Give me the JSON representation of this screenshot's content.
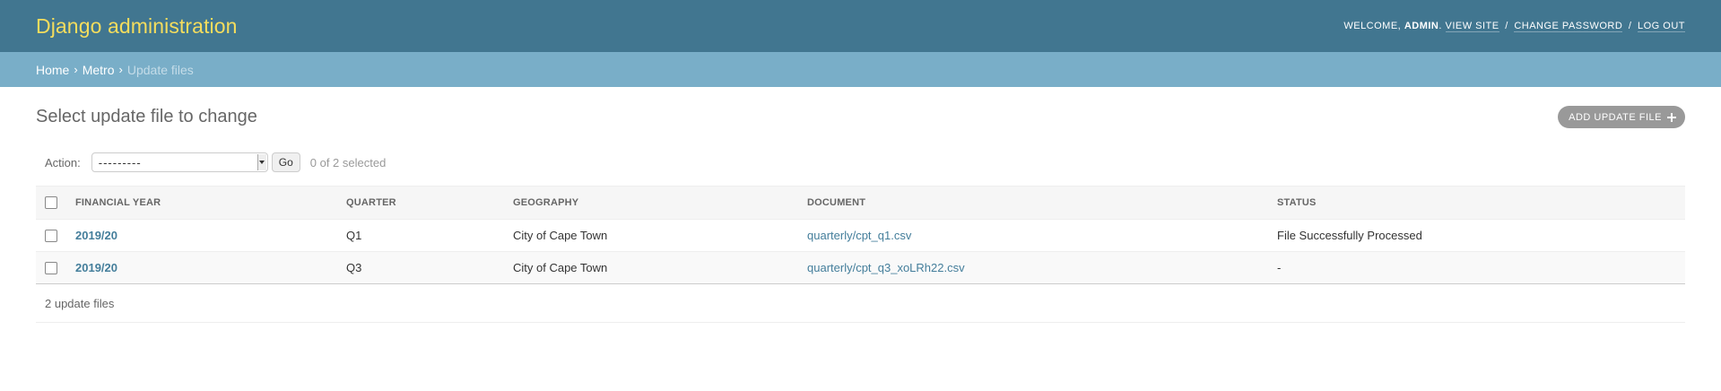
{
  "header": {
    "brand": "Django administration",
    "welcome_prefix": "Welcome,",
    "username": "admin",
    "view_site": "View site",
    "change_password": "Change password",
    "log_out": "Log out"
  },
  "breadcrumbs": {
    "home": "Home",
    "app": "Metro",
    "current": "Update files",
    "separator": "›"
  },
  "page": {
    "title": "Select update file to change",
    "add_button": "Add update file"
  },
  "actions": {
    "label": "Action:",
    "selected_option": "---------",
    "go": "Go",
    "selection_count": "0 of 2 selected"
  },
  "table": {
    "columns": [
      "Financial year",
      "Quarter",
      "Geography",
      "Document",
      "Status"
    ],
    "rows": [
      {
        "financial_year": "2019/20",
        "quarter": "Q1",
        "geography": "City of Cape Town",
        "document": "quarterly/cpt_q1.csv",
        "status": "File Successfully Processed"
      },
      {
        "financial_year": "2019/20",
        "quarter": "Q3",
        "geography": "City of Cape Town",
        "document": "quarterly/cpt_q3_xoLRh22.csv",
        "status": "-"
      }
    ]
  },
  "paginator": {
    "text": "2 update files"
  },
  "colors": {
    "header_bg": "#417690",
    "brand": "#f5dd5d",
    "breadcrumbs_bg": "#79aec8",
    "link": "#447e9b"
  }
}
